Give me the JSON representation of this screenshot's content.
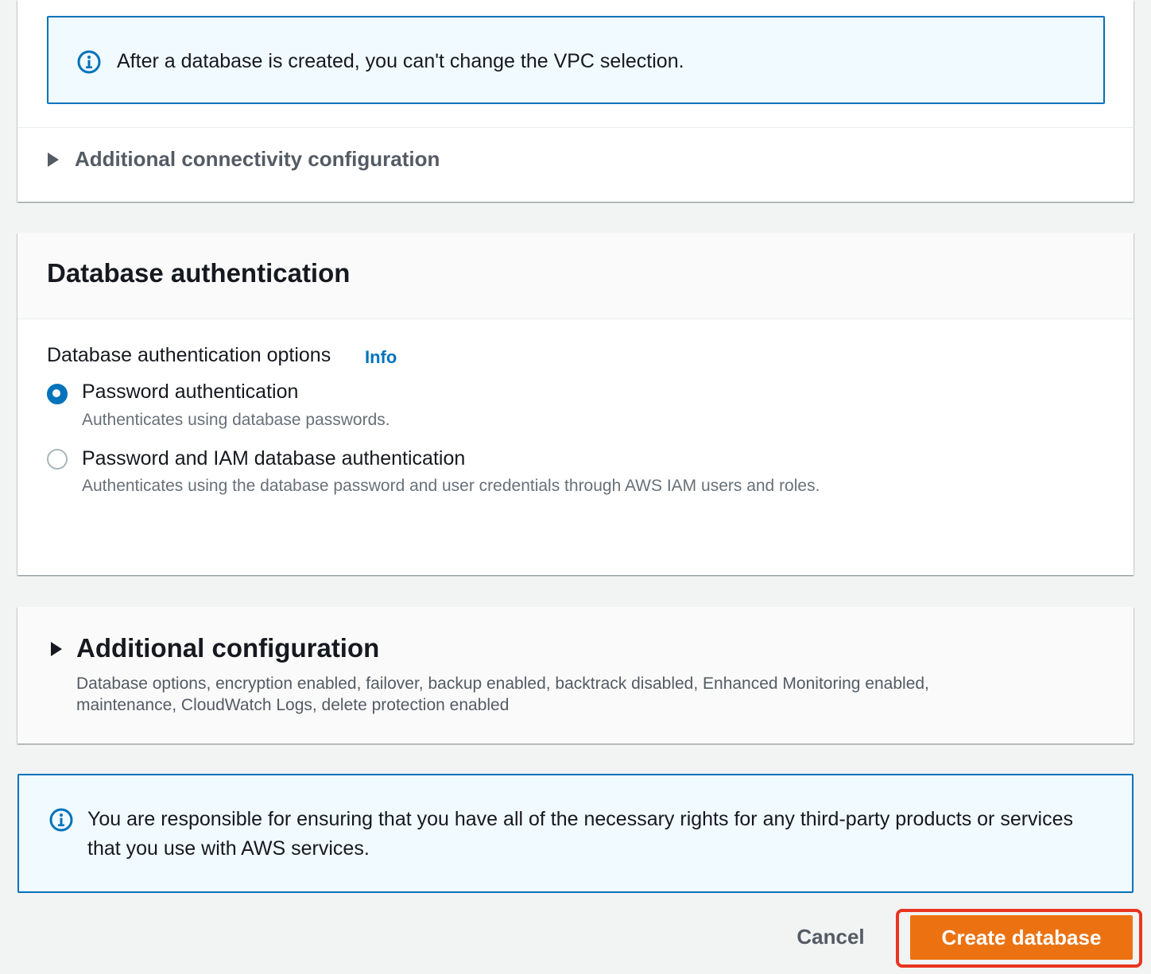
{
  "connectivity": {
    "vpc_alert": "After a database is created, you can't change the VPC selection.",
    "additional_connectivity_label": "Additional connectivity configuration"
  },
  "db_auth": {
    "title": "Database authentication",
    "options_label": "Database authentication options",
    "info_link": "Info",
    "options": [
      {
        "label": "Password authentication",
        "description": "Authenticates using database passwords.",
        "selected": true
      },
      {
        "label": "Password and IAM database authentication",
        "description": "Authenticates using the database password and user credentials through AWS IAM users and roles.",
        "selected": false
      }
    ]
  },
  "additional_config": {
    "title": "Additional configuration",
    "description": "Database options, encryption enabled, failover, backup enabled, backtrack disabled, Enhanced Monitoring enabled, maintenance, CloudWatch Logs, delete protection enabled"
  },
  "rights_alert": "You are responsible for ensuring that you have all of the necessary rights for any third-party products or services that you use with AWS services.",
  "actions": {
    "cancel_label": "Cancel",
    "create_label": "Create database"
  },
  "colors": {
    "accent": "#0073bb",
    "primary_button": "#ec7211",
    "highlight": "#e8351f"
  }
}
